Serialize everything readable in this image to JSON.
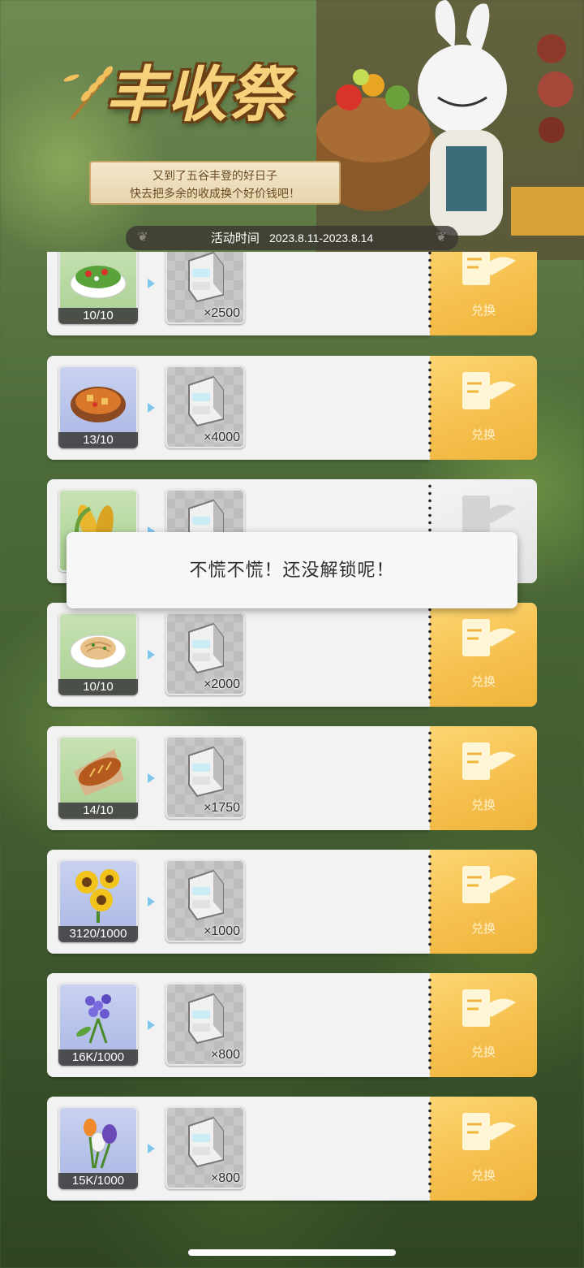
{
  "event": {
    "title": "丰收祭",
    "subtitle_lines": [
      "又到了五谷丰登的好日子",
      "快去把多余的收成换个好价钱吧！"
    ],
    "time_label": "活动时间",
    "time_range": "2023.8.11-2023.8.14"
  },
  "rows": [
    {
      "item": "salad",
      "bg": "green",
      "count": "10/10",
      "reward_qty": "×2500",
      "button": "兑换",
      "locked": false
    },
    {
      "item": "stew",
      "bg": "blue",
      "count": "13/10",
      "reward_qty": "×4000",
      "button": "兑换",
      "locked": false
    },
    {
      "item": "corn",
      "bg": "green",
      "count": "",
      "reward_qty": "",
      "button": "",
      "locked": true
    },
    {
      "item": "pasta",
      "bg": "green",
      "count": "10/10",
      "reward_qty": "×2000",
      "button": "兑换",
      "locked": false
    },
    {
      "item": "bread",
      "bg": "green",
      "count": "14/10",
      "reward_qty": "×1750",
      "button": "兑换",
      "locked": false
    },
    {
      "item": "sunflowers",
      "bg": "blue",
      "count": "3120/1000",
      "reward_qty": "×1000",
      "button": "兑换",
      "locked": false
    },
    {
      "item": "lavender",
      "bg": "blue",
      "count": "16K/1000",
      "reward_qty": "×800",
      "button": "兑换",
      "locked": false
    },
    {
      "item": "tulips",
      "bg": "blue",
      "count": "15K/1000",
      "reward_qty": "×800",
      "button": "兑换",
      "locked": false
    }
  ],
  "toast": {
    "message": "不慌不慌！还没解锁呢！"
  },
  "colors": {
    "ticket": "#f6c04e",
    "arrow": "#7ec6ee",
    "title": "#f6d27c"
  }
}
